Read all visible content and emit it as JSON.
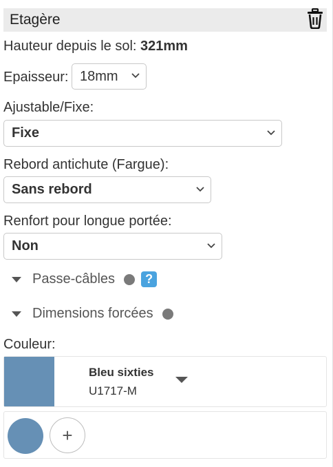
{
  "header": {
    "title": "Etagère",
    "delete_icon": "trash-icon"
  },
  "height": {
    "label": "Hauteur depuis le sol:",
    "value": "321mm"
  },
  "thickness": {
    "label": "Epaisseur:",
    "value": "18mm"
  },
  "mount": {
    "label": "Ajustable/Fixe:",
    "value": "Fixe"
  },
  "lip": {
    "label": "Rebord antichute (Fargue):",
    "value": "Sans rebord"
  },
  "reinforcement": {
    "label": "Renfort pour longue portée:",
    "value": "Non"
  },
  "sections": [
    {
      "label": "Passe-câbles",
      "help": "?"
    },
    {
      "label": "Dimensions forcées"
    }
  ],
  "color": {
    "label": "Couleur:",
    "name": "Bleu sixties",
    "code": "U1717-M",
    "swatch_hex": "#6690b5"
  },
  "chips": {
    "selected_hex": "#6690b5",
    "add_symbol": "+"
  },
  "colors": {
    "header_bg": "#ebebeb",
    "help_blue": "#4aa3df",
    "dot_gray": "#7a7a7a"
  }
}
